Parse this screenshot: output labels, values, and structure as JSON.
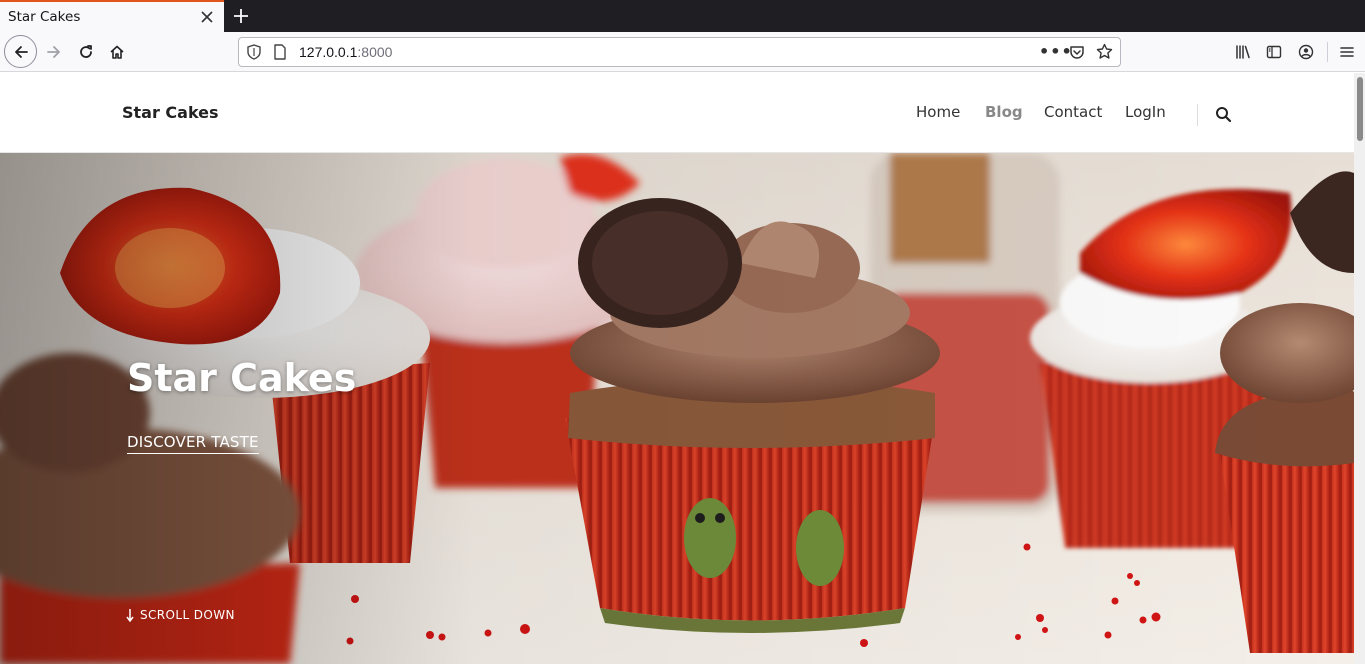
{
  "browser": {
    "tab_title": "Star Cakes",
    "url_host": "127.0.0.1",
    "url_port": ":8000",
    "icons": [
      "close-icon",
      "plus-icon",
      "back-icon",
      "forward-icon",
      "reload-icon",
      "home-icon",
      "shield-icon",
      "page-icon",
      "more-icon",
      "pocket-icon",
      "star-icon",
      "library-icon",
      "sidebar-icon",
      "account-icon",
      "menu-icon"
    ]
  },
  "site": {
    "logo": "Star Cakes",
    "nav": {
      "home": "Home",
      "blog": "Blog",
      "contact": "Contact",
      "login": "LogIn"
    },
    "search_icon": "search-icon"
  },
  "hero": {
    "title": "Star Cakes",
    "cta": "DISCOVER TASTE",
    "scroll_label": "SCROLL DOWN"
  },
  "colors": {
    "tab_accent": "#e0561d",
    "nav_active": "#888888",
    "hero_text": "#ffffff"
  }
}
